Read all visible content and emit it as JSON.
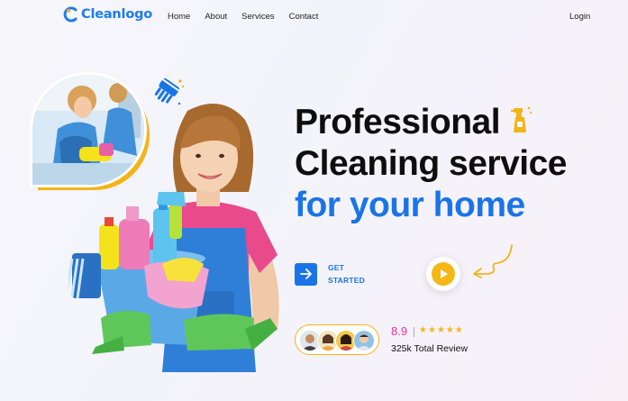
{
  "nav": {
    "logo_text": "Cleanlogo",
    "items": [
      "Home",
      "About",
      "Services",
      "Contact"
    ],
    "login": "Login"
  },
  "hero": {
    "line1": "Professional",
    "line2": "Cleaning service",
    "line3": "for your home",
    "cta_label": "GET STARTED"
  },
  "review": {
    "score": "8.9",
    "stars": "★★★★★",
    "total": "325k Total Review"
  },
  "colors": {
    "brand_blue": "#1a74e8",
    "accent_yellow": "#f4b418",
    "score_pink": "#e7329b"
  },
  "icons": [
    "logo-mark-icon",
    "cleaning-gloves-icon",
    "spray-bottle-icon",
    "arrow-right-icon",
    "play-icon",
    "curved-arrow-icon"
  ]
}
